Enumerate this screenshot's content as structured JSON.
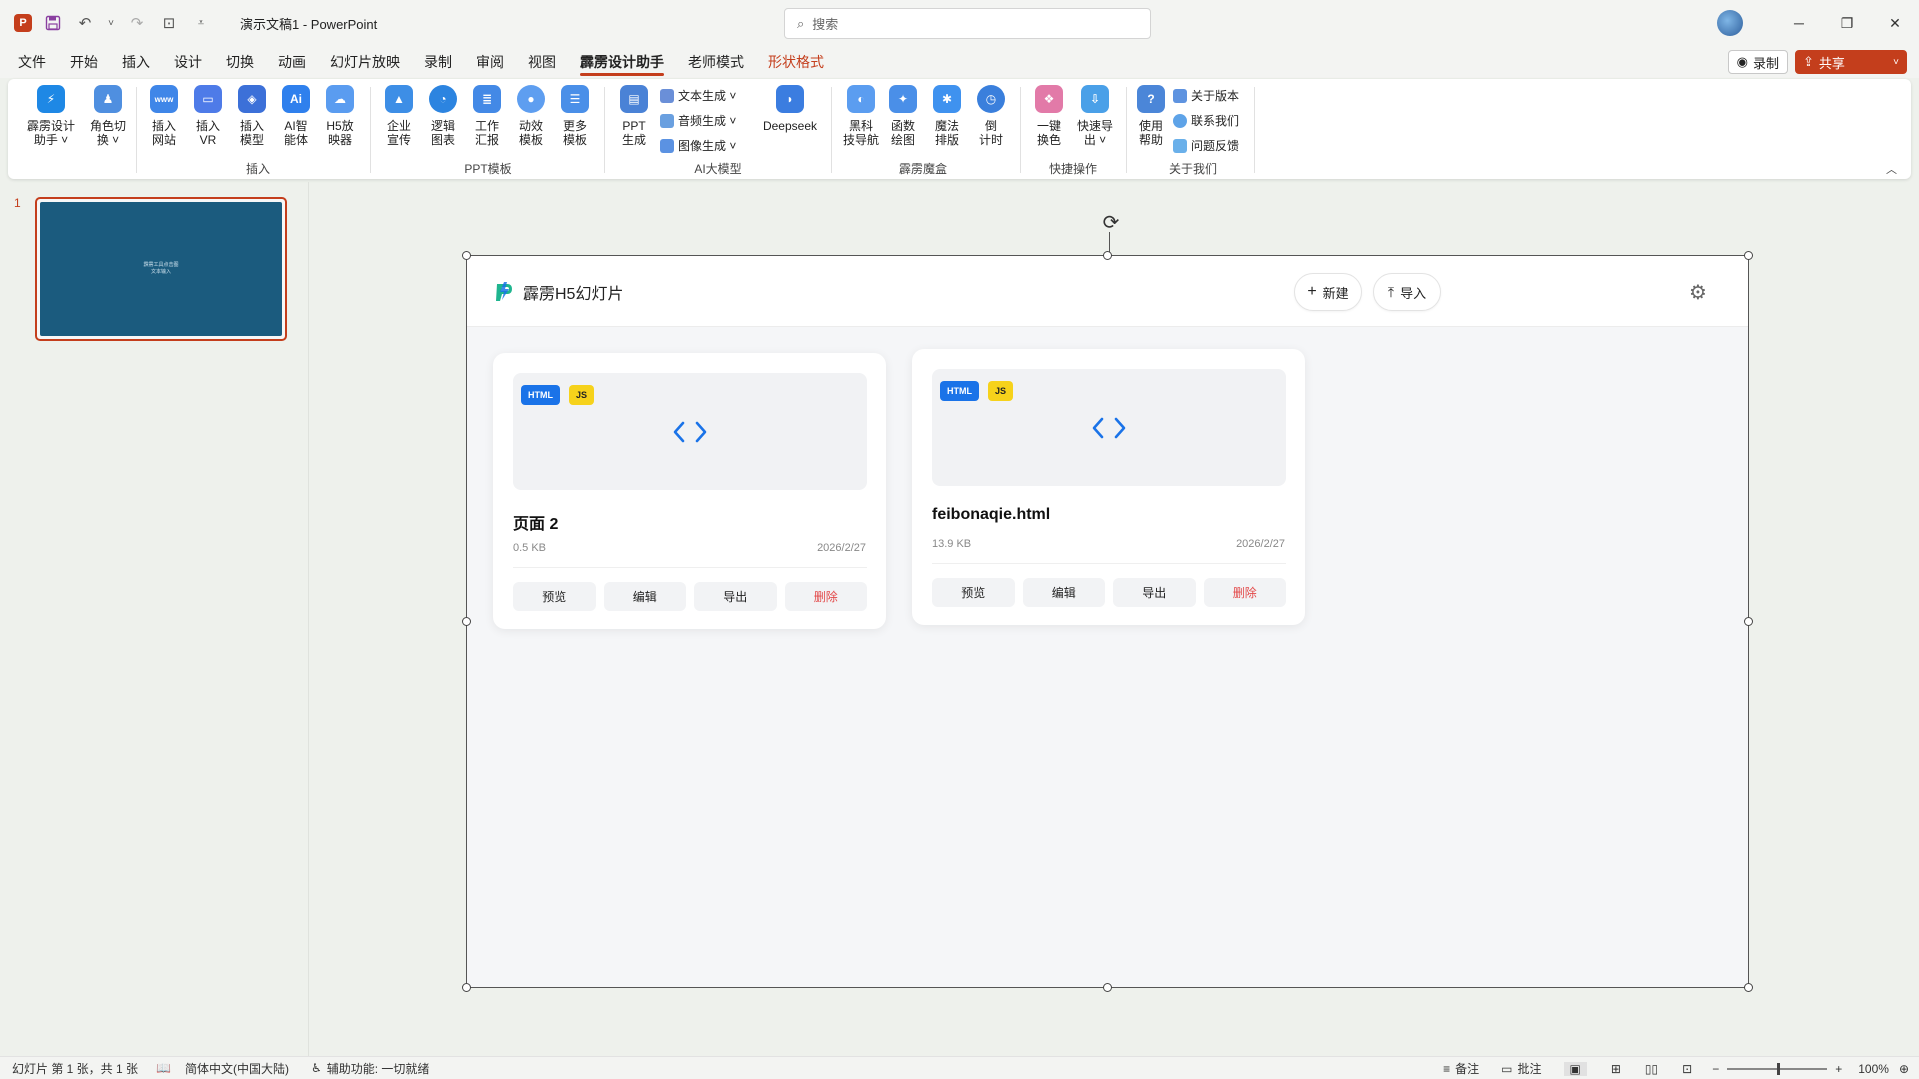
{
  "window": {
    "doc_title": "演示文稿1  -  PowerPoint",
    "search_placeholder": "搜索",
    "app_logo": "P"
  },
  "menu": {
    "tabs": [
      "文件",
      "开始",
      "插入",
      "设计",
      "切换",
      "动画",
      "幻灯片放映",
      "录制",
      "审阅",
      "视图",
      "霹雳设计助手",
      "老师模式",
      "形状格式"
    ],
    "active_tab": "霹雳设计助手",
    "record_label": "录制",
    "share_label": "共享"
  },
  "ribbon": {
    "buttons": [
      {
        "label": "霹雳设计\n助手 ˅",
        "icon": "lightning-icon",
        "color": "#1e88e5"
      },
      {
        "label": "角色切\n换 ˅",
        "icon": "role-switch-icon",
        "color": "#4f8fe0"
      },
      {
        "label": "插入\n网站",
        "icon": "www-icon",
        "color": "#3f86e8"
      },
      {
        "label": "插入\nVR",
        "icon": "vr-icon",
        "color": "#4e7be8"
      },
      {
        "label": "插入\n模型",
        "icon": "cube-icon",
        "color": "#3c70d8"
      },
      {
        "label": "AI智\n能体",
        "icon": "ai-icon",
        "color": "#2f80ed"
      },
      {
        "label": "H5放\n映器",
        "icon": "cloud-icon",
        "color": "#5a9cf0"
      },
      {
        "label": "企业\n宣传",
        "icon": "company-icon",
        "color": "#3d8ee6"
      },
      {
        "label": "逻辑\n图表",
        "icon": "chart-icon",
        "color": "#2c84e0"
      },
      {
        "label": "工作\n汇报",
        "icon": "report-icon",
        "color": "#4389e6"
      },
      {
        "label": "动效\n模板",
        "icon": "motion-icon",
        "color": "#5e9ef0"
      },
      {
        "label": "更多\n模板",
        "icon": "stack-icon",
        "color": "#4a8fe8"
      },
      {
        "label": "PPT\n生成",
        "icon": "ppt-gen-icon",
        "color": "#4a82d6"
      },
      {
        "label": "Deepseek",
        "icon": "whale-icon",
        "color": "#3b7de0"
      },
      {
        "label": "黑科\n技导航",
        "icon": "nav-icon",
        "color": "#5b9df0"
      },
      {
        "label": "函数\n绘图",
        "icon": "function-icon",
        "color": "#4a8fe8"
      },
      {
        "label": "魔法\n排版",
        "icon": "sparkle-icon",
        "color": "#3f92ef"
      },
      {
        "label": "倒\n计时",
        "icon": "clock-icon",
        "color": "#3a7fdc"
      },
      {
        "label": "一键\n换色",
        "icon": "palette-icon",
        "color": "#e27aa8"
      },
      {
        "label": "快速导\n出 ˅",
        "icon": "export-icon",
        "color": "#4aa0e8"
      },
      {
        "label": "使用\n帮助",
        "icon": "help-icon",
        "color": "#4b86d8"
      }
    ],
    "small_buttons": [
      {
        "label": "文本生成 ˅",
        "icon": "text-gen-icon"
      },
      {
        "label": "音频生成 ˅",
        "icon": "audio-gen-icon"
      },
      {
        "label": "图像生成 ˅",
        "icon": "image-gen-icon"
      },
      {
        "label": "关于版本",
        "icon": "version-icon"
      },
      {
        "label": "联系我们",
        "icon": "contact-icon"
      },
      {
        "label": "问题反馈",
        "icon": "feedback-icon"
      }
    ],
    "groups": [
      "插入",
      "PPT模板",
      "AI大模型",
      "霹雳魔盒",
      "快捷操作",
      "关于我们"
    ]
  },
  "thumbnails": {
    "slide_number": "1",
    "thumb_lines": [
      "霹雳工具点击图",
      "文本输入"
    ]
  },
  "h5app": {
    "brand_name": "霹雳H5幻灯片",
    "new_label": "新建",
    "import_label": "导入",
    "cards": [
      {
        "title": "页面 2",
        "size": "0.5 KB",
        "date": "2026/2/27",
        "badges": [
          "HTML",
          "JS"
        ],
        "actions": [
          "预览",
          "编辑",
          "导出",
          "删除"
        ]
      },
      {
        "title": "feibonaqie.html",
        "size": "13.9 KB",
        "date": "2026/2/27",
        "badges": [
          "HTML",
          "JS"
        ],
        "actions": [
          "预览",
          "编辑",
          "导出",
          "删除"
        ]
      }
    ]
  },
  "status": {
    "slide_info": "幻灯片 第 1 张，共 1 张",
    "language": "简体中文(中国大陆)",
    "accessibility": "辅助功能: 一切就绪",
    "notes": "备注",
    "comments": "批注",
    "zoom": "100%",
    "zoom_level": 0.5
  },
  "colors": {
    "accent": "#c43e1c",
    "html_badge": "#1a73e8",
    "js_badge": "#f6d21b",
    "delete": "#e34848",
    "thumb_bg": "#1b5b7e"
  }
}
